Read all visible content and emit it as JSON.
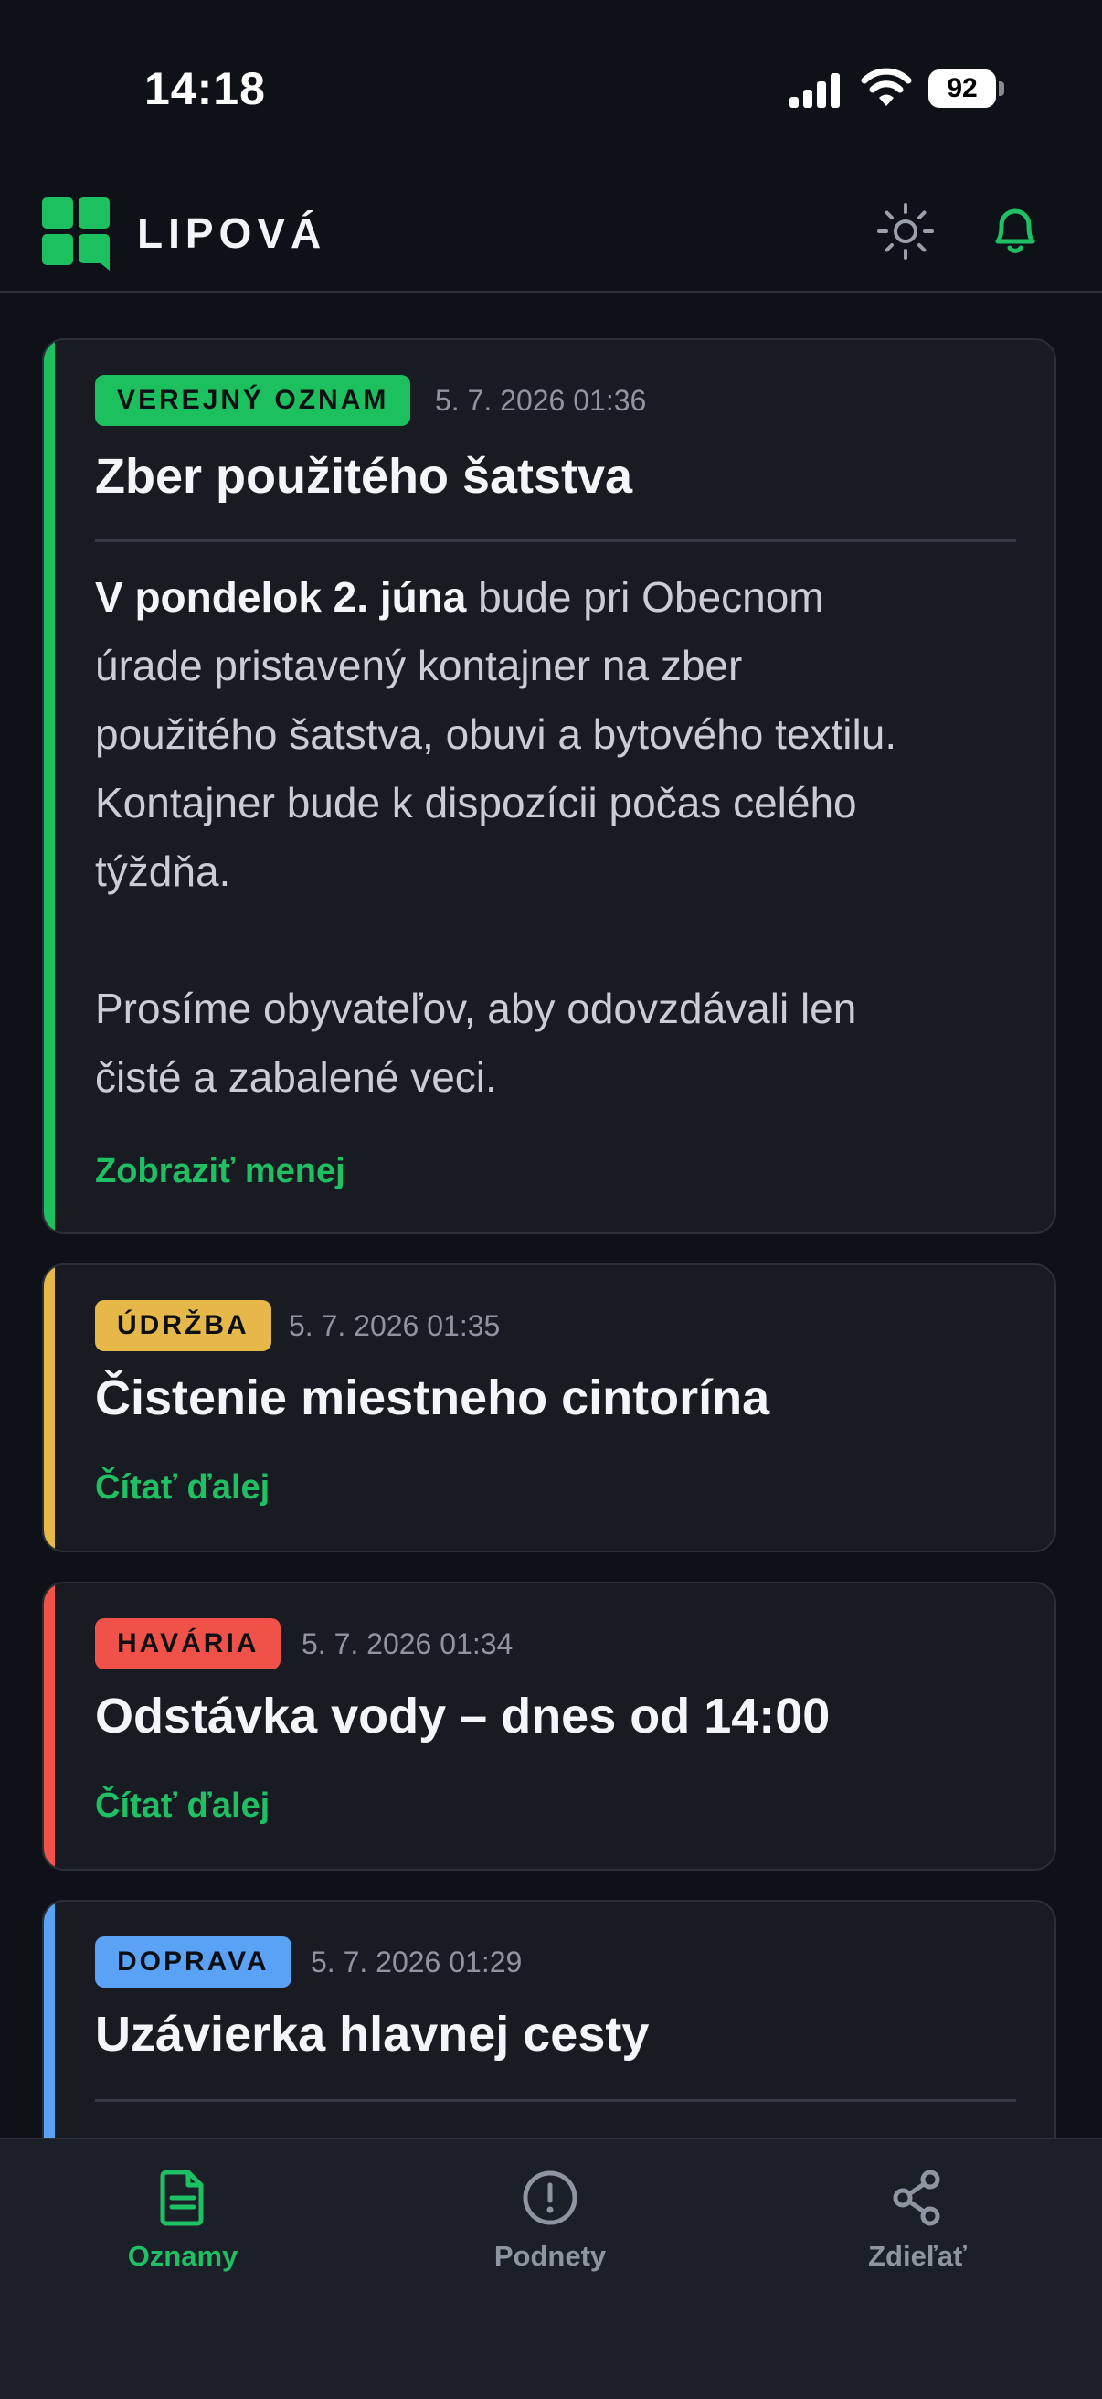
{
  "status": {
    "time": "14:18",
    "battery": "92"
  },
  "header": {
    "brand": "LIPOVÁ"
  },
  "cards": [
    {
      "badge": "VEREJNÝ OZNAM",
      "date": "5. 7. 2026 01:36",
      "title": "Zber použitého šatstva",
      "body_bold": "V pondelok 2. júna",
      "body_lines": [
        " bude pri Obecnom",
        "úrade pristavený kontajner na zber",
        "použitého šatstva, obuvi a bytového textilu.",
        "Kontajner bude k dispozícii počas celého",
        "týždňa.",
        "",
        "Prosíme obyvateľov, aby odovzdávali len",
        "čisté a zabalené veci."
      ],
      "link": "Zobraziť menej",
      "color": "#1cc05f"
    },
    {
      "badge": "ÚDRŽBA",
      "date": "5. 7. 2026 01:35",
      "title": "Čistenie miestneho cintorína",
      "link": "Čítať ďalej",
      "color": "#e6b84a"
    },
    {
      "badge": "HAVÁRIA",
      "date": "5. 7. 2026 01:34",
      "title": "Odstávka vody – dnes od 14:00",
      "link": "Čítať ďalej",
      "color": "#f0524a"
    },
    {
      "badge": "DOPRAVA",
      "date": "5. 7. 2026 01:29",
      "title": "Uzávierka hlavnej cesty",
      "color": "#5aa2f5"
    }
  ],
  "tabs": [
    {
      "label": "Oznamy",
      "icon": "document-icon",
      "active": true
    },
    {
      "label": "Podnety",
      "icon": "alert-circle-icon",
      "active": false
    },
    {
      "label": "Zdieľať",
      "icon": "share-icon",
      "active": false
    }
  ],
  "colors": {
    "accent": "#1fbf64",
    "background": "#0e1117",
    "card": "#181b22",
    "inactive": "#8e95a0"
  }
}
